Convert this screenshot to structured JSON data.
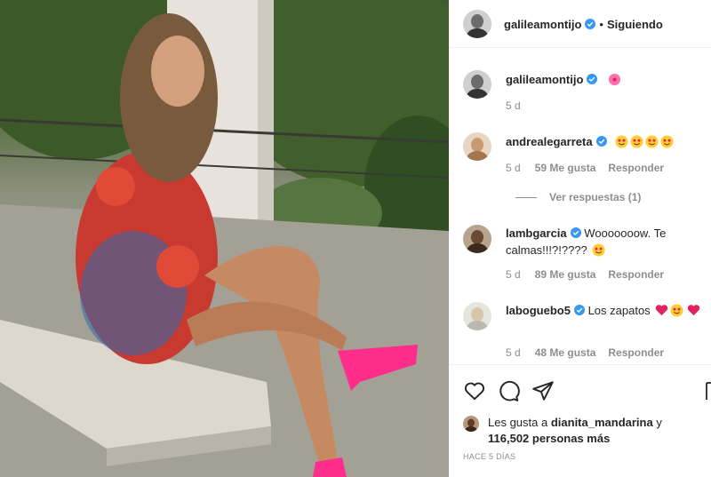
{
  "post": {
    "username": "galileamontijo",
    "follow_status": "Siguiendo",
    "caption_username": "galileamontijo",
    "caption_emoji": "hibiscus-emoji",
    "caption_age": "5 d"
  },
  "comments": [
    {
      "username": "andrealegarreta",
      "text": "",
      "emojis": [
        "star-struck-emoji",
        "star-struck-emoji",
        "star-struck-emoji",
        "star-struck-emoji"
      ],
      "age": "5 d",
      "likes": "59 Me gusta",
      "reply_label": "Responder",
      "view_replies": "Ver respuestas (1)"
    },
    {
      "username": "lambgarcia",
      "text": "Wooooooow. Te calmas!!!?!????",
      "emojis": [
        "star-struck-emoji"
      ],
      "age": "5 d",
      "likes": "89 Me gusta",
      "reply_label": "Responder"
    },
    {
      "username": "laboguebo5",
      "text": "Los zapatos",
      "emojis": [
        "red-heart-emoji",
        "star-struck-emoji",
        "red-heart-emoji"
      ],
      "age": "5 d",
      "likes": "48 Me gusta",
      "reply_label": "Responder"
    }
  ],
  "actions": {
    "icons": [
      "heart-icon",
      "comment-icon",
      "share-icon",
      "bookmark-icon"
    ],
    "liked_by_prefix": "Les gusta a",
    "liked_by_user": "dianita_mandarina",
    "liked_by_joiner": "y",
    "others_count": "116,502 personas más",
    "post_date": "HACE 5 DÍAS"
  },
  "colors": {
    "text": "#262626",
    "secondary": "#8e8e8e",
    "verified": "#3897f0",
    "divider": "#efefef",
    "heart_emoji": "#e0245e",
    "star_emoji": "#ffcc33"
  }
}
